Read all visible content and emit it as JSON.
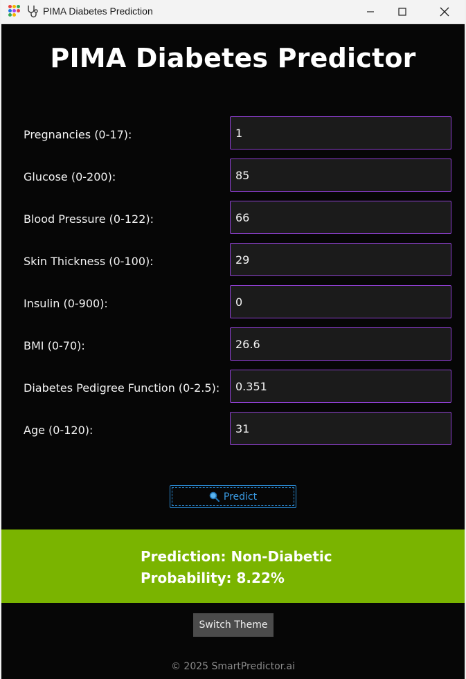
{
  "window": {
    "title": "PIMA Diabetes Prediction",
    "icons": [
      "app-logo-icon",
      "stethoscope-icon"
    ],
    "controls": [
      "minimize-icon",
      "maximize-icon",
      "close-icon"
    ]
  },
  "page": {
    "heading": "PIMA Diabetes Predictor"
  },
  "fields": [
    {
      "label": "Pregnancies (0-17):",
      "value": "1"
    },
    {
      "label": "Glucose (0-200):",
      "value": "85"
    },
    {
      "label": "Blood Pressure (0-122):",
      "value": "66"
    },
    {
      "label": "Skin Thickness (0-100):",
      "value": "29"
    },
    {
      "label": "Insulin (0-900):",
      "value": "0"
    },
    {
      "label": "BMI (0-70):",
      "value": "26.6"
    },
    {
      "label": "Diabetes Pedigree Function (0-2.5):",
      "value": "0.351"
    },
    {
      "label": "Age (0-120):",
      "value": "31"
    }
  ],
  "predict": {
    "label": "Predict",
    "icon": "magnifier-icon"
  },
  "result": {
    "prediction": "Prediction: Non-Diabetic",
    "probability": "Probability: 8.22%"
  },
  "theme_button": "Switch Theme",
  "footer": "© 2025 SmartPredictor.ai",
  "colors": {
    "background": "#060606",
    "input_border": "#8e3fd0",
    "result_bg": "#7ab400",
    "predict_accent": "#2a8ad4"
  }
}
